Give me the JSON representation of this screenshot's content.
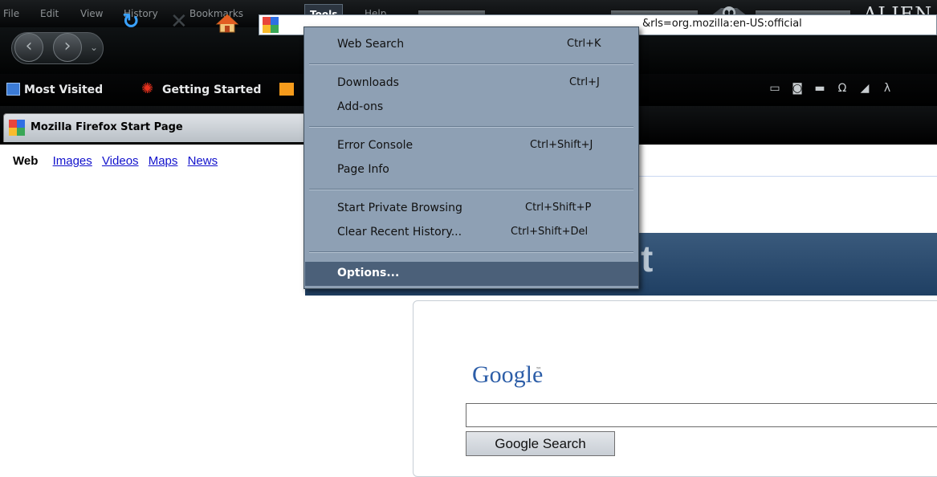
{
  "menubar": {
    "items": [
      "File",
      "Edit",
      "View",
      "History",
      "Bookmarks",
      "Tools",
      "Help"
    ],
    "active": "Tools",
    "brand": "ALIEN"
  },
  "urlbar": {
    "text": "&rls=org.mozilla:en-US:official"
  },
  "bookmarks": {
    "items": [
      "Most Visited",
      "Getting Started"
    ]
  },
  "tab": {
    "title": "Mozilla Firefox Start Page"
  },
  "google_nav": {
    "current": "Web",
    "links": [
      "Images",
      "Videos",
      "Maps",
      "News"
    ]
  },
  "page": {
    "banner_fragment": "t",
    "logo": "Google",
    "logo_tm": "™",
    "search_value": "",
    "search_button": "Google Search"
  },
  "tools_menu": {
    "groups": [
      [
        {
          "label": "Web Search",
          "accel": "Ctrl+K"
        }
      ],
      [
        {
          "label": "Downloads",
          "accel": "Ctrl+J"
        },
        {
          "label": "Add-ons",
          "accel": ""
        }
      ],
      [
        {
          "label": "Error Console",
          "accel": "Ctrl+Shift+J"
        },
        {
          "label": "Page Info",
          "accel": ""
        }
      ],
      [
        {
          "label": "Start Private Browsing",
          "accel": "Ctrl+Shift+P"
        },
        {
          "label": "Clear Recent History...",
          "accel": "Ctrl+Shift+Del"
        }
      ],
      [
        {
          "label": "Options...",
          "accel": "",
          "selected": true
        }
      ]
    ]
  },
  "colors": {
    "menu_bg": "#8ea0b4",
    "menu_selected": "#4b6079",
    "chrome_dark": "#050607",
    "link_blue": "#1111cc",
    "banner": "#2d4d70"
  },
  "icons": [
    "back-icon",
    "forward-icon",
    "reload-icon",
    "stop-icon",
    "home-icon",
    "alien-head-icon"
  ]
}
